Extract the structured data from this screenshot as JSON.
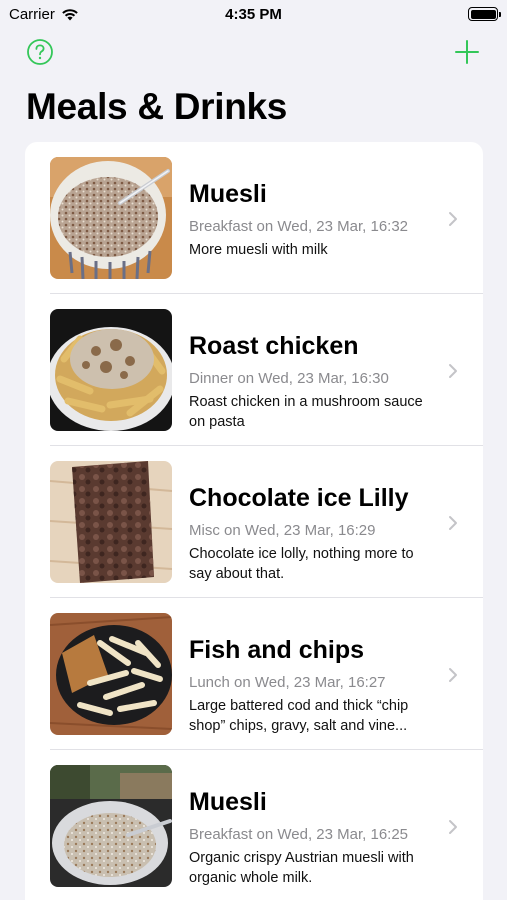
{
  "status_bar": {
    "carrier": "Carrier",
    "time": "4:35 PM"
  },
  "nav": {
    "title": "Meals & Drinks",
    "help_icon": "question-circle-icon",
    "add_icon": "plus-icon",
    "accent_color": "#34c759"
  },
  "meals": [
    {
      "name": "Muesli",
      "meta": "Breakfast on Wed, 23 Mar, 16:32",
      "description": "More muesli with milk"
    },
    {
      "name": "Roast chicken",
      "meta": "Dinner on Wed, 23 Mar, 16:30",
      "description": "Roast chicken in a mushroom sauce on pasta"
    },
    {
      "name": "Chocolate ice Lilly",
      "meta": "Misc on Wed, 23 Mar, 16:29",
      "description": "Chocolate ice lolly, nothing more to say about that."
    },
    {
      "name": "Fish and chips",
      "meta": "Lunch on Wed, 23 Mar, 16:27",
      "description": "Large battered cod and thick “chip shop” chips, gravy, salt and vine..."
    },
    {
      "name": "Muesli",
      "meta": "Breakfast on Wed, 23 Mar, 16:25",
      "description": "Organic crispy Austrian muesli with organic whole milk."
    }
  ]
}
